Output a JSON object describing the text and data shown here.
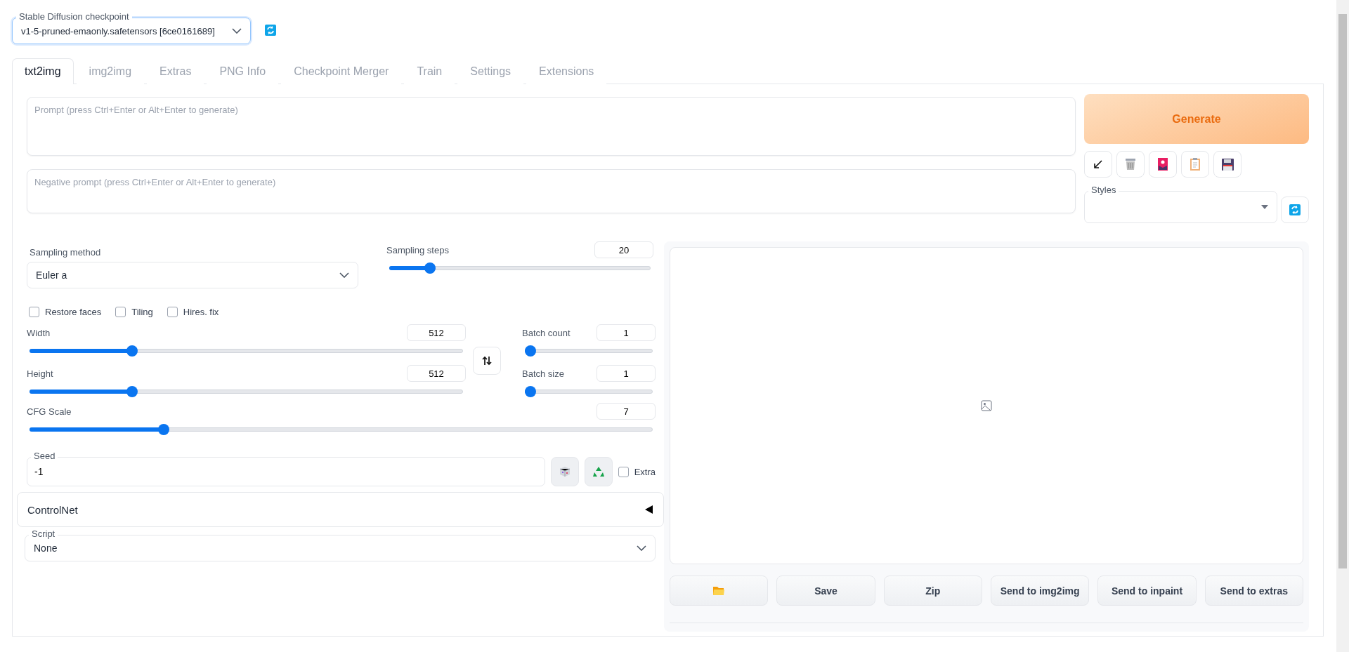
{
  "checkpoint": {
    "label": "Stable Diffusion checkpoint",
    "value": "v1-5-pruned-emaonly.safetensors [6ce0161689]"
  },
  "tabs": [
    {
      "label": "txt2img",
      "selected": true
    },
    {
      "label": "img2img",
      "selected": false
    },
    {
      "label": "Extras",
      "selected": false
    },
    {
      "label": "PNG Info",
      "selected": false
    },
    {
      "label": "Checkpoint Merger",
      "selected": false
    },
    {
      "label": "Train",
      "selected": false
    },
    {
      "label": "Settings",
      "selected": false
    },
    {
      "label": "Extensions",
      "selected": false
    }
  ],
  "prompt": {
    "placeholder": "Prompt (press Ctrl+Enter or Alt+Enter to generate)"
  },
  "negative_prompt": {
    "placeholder": "Negative prompt (press Ctrl+Enter or Alt+Enter to generate)"
  },
  "generate": {
    "label": "Generate"
  },
  "tools": [
    {
      "kind": "arrow"
    },
    {
      "kind": "trash"
    },
    {
      "kind": "picture-card"
    },
    {
      "kind": "clipboard"
    },
    {
      "kind": "save"
    }
  ],
  "styles": {
    "label": "Styles"
  },
  "sampling_method": {
    "label": "Sampling method",
    "value": "Euler a"
  },
  "sampling_steps": {
    "label": "Sampling steps",
    "value": "20",
    "level": 0.14
  },
  "checkboxes": [
    {
      "label": "Restore faces",
      "checked": false
    },
    {
      "label": "Tiling",
      "checked": false
    },
    {
      "label": "Hires. fix",
      "checked": false
    }
  ],
  "width": {
    "label": "Width",
    "value": "512",
    "level": 0.23
  },
  "height": {
    "label": "Height",
    "value": "512",
    "level": 0.23
  },
  "batch_count": {
    "label": "Batch count",
    "value": "1",
    "level": 0
  },
  "batch_size": {
    "label": "Batch size",
    "value": "1",
    "level": 0
  },
  "cfg_scale": {
    "label": "CFG Scale",
    "value": "7",
    "level": 0.21
  },
  "seed": {
    "label": "Seed",
    "value": "-1",
    "extra": {
      "label": "Extra",
      "checked": false
    }
  },
  "controlnet": {
    "label": "ControlNet",
    "expanded": false
  },
  "script": {
    "label": "Script",
    "value": "None"
  },
  "gallery_buttons": [
    {
      "kind": "folder"
    },
    {
      "kind": "text",
      "label": "Save"
    },
    {
      "kind": "text",
      "label": "Zip"
    },
    {
      "kind": "text",
      "label": "Send to img2img"
    },
    {
      "kind": "text",
      "label": "Send to inpaint"
    },
    {
      "kind": "text",
      "label": "Send to extras"
    }
  ]
}
